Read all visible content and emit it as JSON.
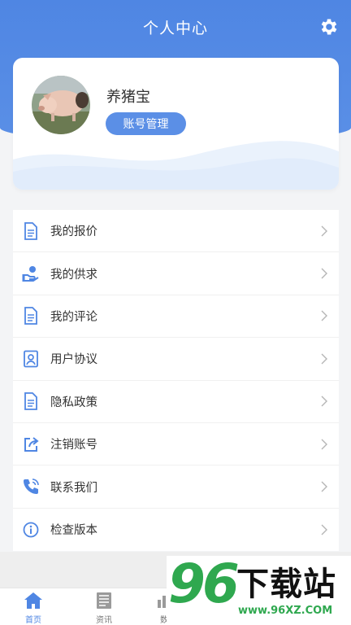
{
  "header": {
    "title": "个人中心",
    "settings_icon": "gear-icon"
  },
  "profile": {
    "username": "养猪宝",
    "account_button": "账号管理"
  },
  "menu": [
    {
      "label": "我的报价",
      "icon": "document-icon"
    },
    {
      "label": "我的供求",
      "icon": "supply-icon"
    },
    {
      "label": "我的评论",
      "icon": "document-icon"
    },
    {
      "label": "用户协议",
      "icon": "agreement-icon"
    },
    {
      "label": "隐私政策",
      "icon": "document-icon"
    },
    {
      "label": "注销账号",
      "icon": "share-icon"
    },
    {
      "label": "联系我们",
      "icon": "phone-icon"
    },
    {
      "label": "检查版本",
      "icon": "info-icon"
    }
  ],
  "tabs": [
    {
      "label": "首页",
      "icon": "home-icon",
      "active": true
    },
    {
      "label": "资讯",
      "icon": "news-icon",
      "active": false
    },
    {
      "label": "数",
      "icon": "data-icon",
      "active": false
    }
  ],
  "watermark": {
    "digits": "96",
    "text": "下载站",
    "url": "www.96XZ.COM"
  },
  "colors": {
    "primary": "#4f86e3",
    "text": "#333333",
    "watermark_green": "#2fa84f"
  }
}
